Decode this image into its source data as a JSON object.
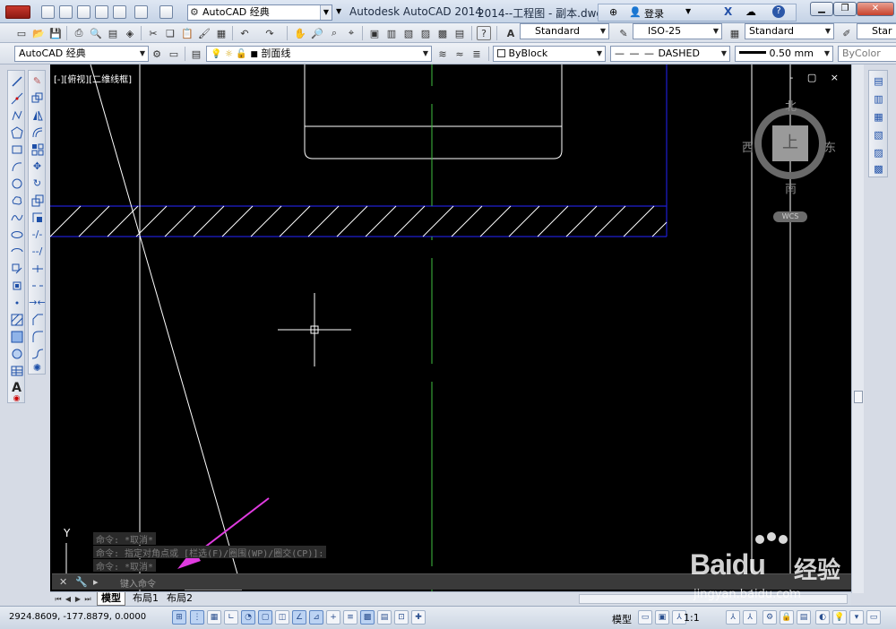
{
  "titlebar": {
    "workspace": "AutoCAD 经典",
    "app_name": "Autodesk AutoCAD 2014",
    "document": "2014--工程图 - 副本.dwg",
    "login": "登录"
  },
  "toolbar": {
    "text_style": "Standard",
    "dim_style": "ISO-25",
    "table_style": "Standard",
    "multileader_style": "Star",
    "workspace": "AutoCAD 经典",
    "layer": "剖面线",
    "color": "ByBlock",
    "linetype": "DASHED",
    "lineweight": "0.50 mm",
    "plot_style": "ByColor"
  },
  "viewport": {
    "label": "[-][俯视][二维线框]",
    "controls": "- ▢ ×"
  },
  "viewcube": {
    "north": "北",
    "south": "南",
    "east": "东",
    "west": "西",
    "top_face": "上",
    "wcs": "WCS"
  },
  "ucs_axis": {
    "y": "Y",
    "x_marker": "1"
  },
  "command": {
    "history": [
      "命令: *取消*",
      "命令: 指定对角点或 [栏选(F)/圈围(WP)/圈交(CP)]:",
      "命令: *取消*"
    ],
    "placeholder": "键入命令"
  },
  "layout_tabs": [
    "模型",
    "布局1",
    "布局2"
  ],
  "status": {
    "coords": "2924.8609, -177.8879, 0.0000",
    "model": "模型",
    "scale": "1:1"
  },
  "watermark": {
    "brand": "Bai",
    "brand_suffix": "du",
    "cn": "经验",
    "url": "jingyan.baidu.com"
  },
  "colors": {
    "canvas_bg": "#000000",
    "hatch_border": "#1f1fd0",
    "centerline": "#3fbf3f",
    "arrow": "#e03be0",
    "lines": "#ffffff"
  }
}
